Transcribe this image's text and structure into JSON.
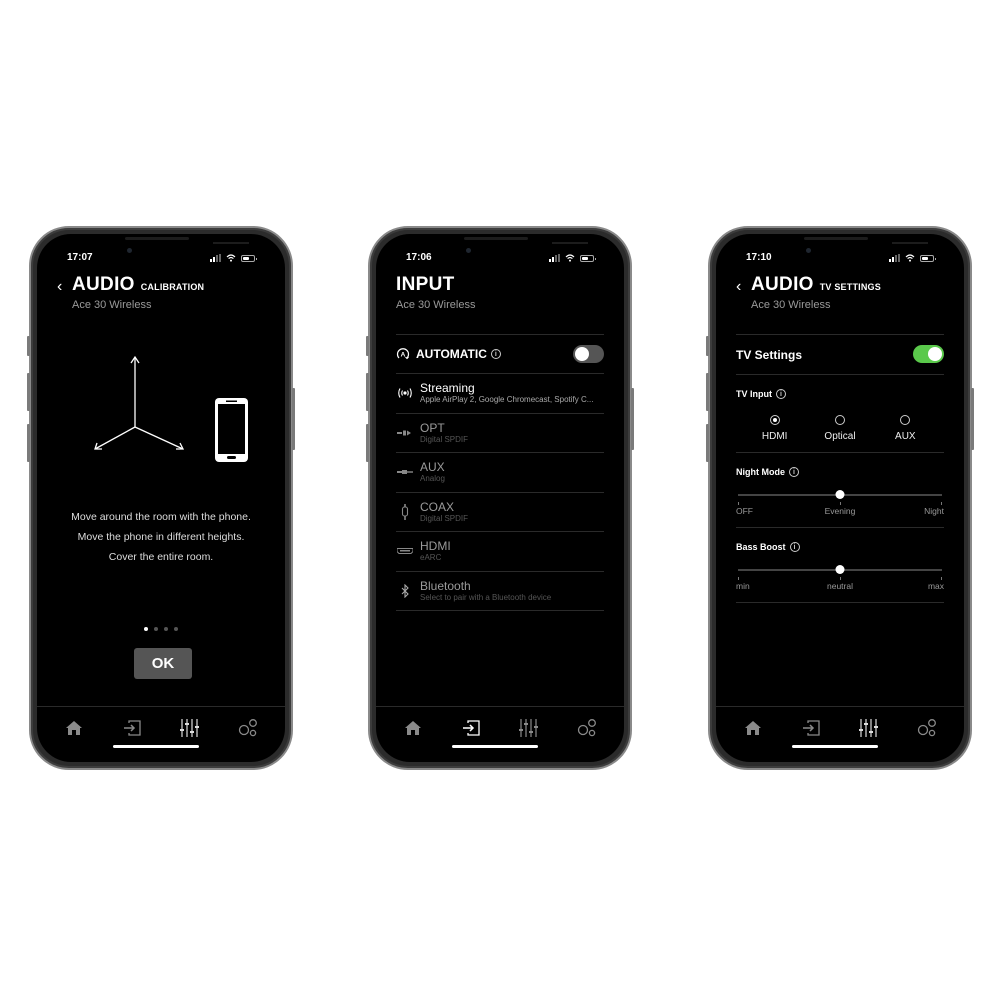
{
  "phones": [
    {
      "status": {
        "time": "17:07"
      },
      "header": {
        "title": "AUDIO",
        "subtitle": "CALIBRATION",
        "device": "Ace 30 Wireless",
        "back_icon": "chevron-left-icon"
      },
      "illustration": {
        "icons": [
          "3d-axes-icon",
          "smartphone-icon"
        ]
      },
      "instructions": [
        "Move around the room with the phone.",
        "Move the phone in different heights.",
        "Cover the entire room."
      ],
      "pager": {
        "total": 4,
        "active": 1
      },
      "ok_label": "OK",
      "tabs": [
        {
          "name": "home",
          "icon": "home-icon",
          "active": false
        },
        {
          "name": "input",
          "icon": "input-icon",
          "active": false
        },
        {
          "name": "audio",
          "icon": "equalizer-icon",
          "active": true
        },
        {
          "name": "settings",
          "icon": "gears-icon",
          "active": false
        }
      ]
    },
    {
      "status": {
        "time": "17:06"
      },
      "header": {
        "title": "INPUT",
        "device": "Ace 30 Wireless"
      },
      "automatic": {
        "label": "AUTOMATIC",
        "icon": "auto-icon",
        "enabled": false
      },
      "inputs": [
        {
          "name": "Streaming",
          "desc": "Apple AirPlay 2, Google Chromecast, Spotify C...",
          "icon": "streaming-icon",
          "available": true
        },
        {
          "name": "OPT",
          "desc": "Digital SPDIF",
          "icon": "optical-icon",
          "available": false
        },
        {
          "name": "AUX",
          "desc": "Analog",
          "icon": "aux-icon",
          "available": false
        },
        {
          "name": "COAX",
          "desc": "Digital SPDIF",
          "icon": "coax-icon",
          "available": false
        },
        {
          "name": "HDMI",
          "desc": "eARC",
          "icon": "hdmi-icon",
          "available": false
        },
        {
          "name": "Bluetooth",
          "desc": "Select to pair with a Bluetooth device",
          "icon": "bluetooth-icon",
          "available": false
        }
      ],
      "tabs": [
        {
          "name": "home",
          "icon": "home-icon",
          "active": false
        },
        {
          "name": "input",
          "icon": "input-icon",
          "active": true
        },
        {
          "name": "audio",
          "icon": "equalizer-icon",
          "active": false
        },
        {
          "name": "settings",
          "icon": "gears-icon",
          "active": false
        }
      ]
    },
    {
      "status": {
        "time": "17:10"
      },
      "header": {
        "title": "AUDIO",
        "subtitle": "TV SETTINGS",
        "device": "Ace 30 Wireless",
        "back_icon": "chevron-left-icon"
      },
      "tv_settings": {
        "label": "TV Settings",
        "enabled": true
      },
      "tv_input": {
        "label": "TV Input",
        "options": [
          "HDMI",
          "Optical",
          "AUX"
        ],
        "selected": "HDMI"
      },
      "night_mode": {
        "label": "Night Mode",
        "stops": [
          "OFF",
          "Evening",
          "Night"
        ],
        "value": "Evening"
      },
      "bass_boost": {
        "label": "Bass Boost",
        "stops": [
          "min",
          "neutral",
          "max"
        ],
        "value": "neutral"
      },
      "tabs": [
        {
          "name": "home",
          "icon": "home-icon",
          "active": false
        },
        {
          "name": "input",
          "icon": "input-icon",
          "active": false
        },
        {
          "name": "audio",
          "icon": "equalizer-icon",
          "active": true
        },
        {
          "name": "settings",
          "icon": "gears-icon",
          "active": false
        }
      ]
    }
  ],
  "colors": {
    "background": "#000000",
    "toggle_on": "#5ac94b",
    "toggle_off": "#555555",
    "ok_button": "#555555",
    "tab_active": "#ffffff",
    "tab_inactive": "#8a8a8a"
  }
}
